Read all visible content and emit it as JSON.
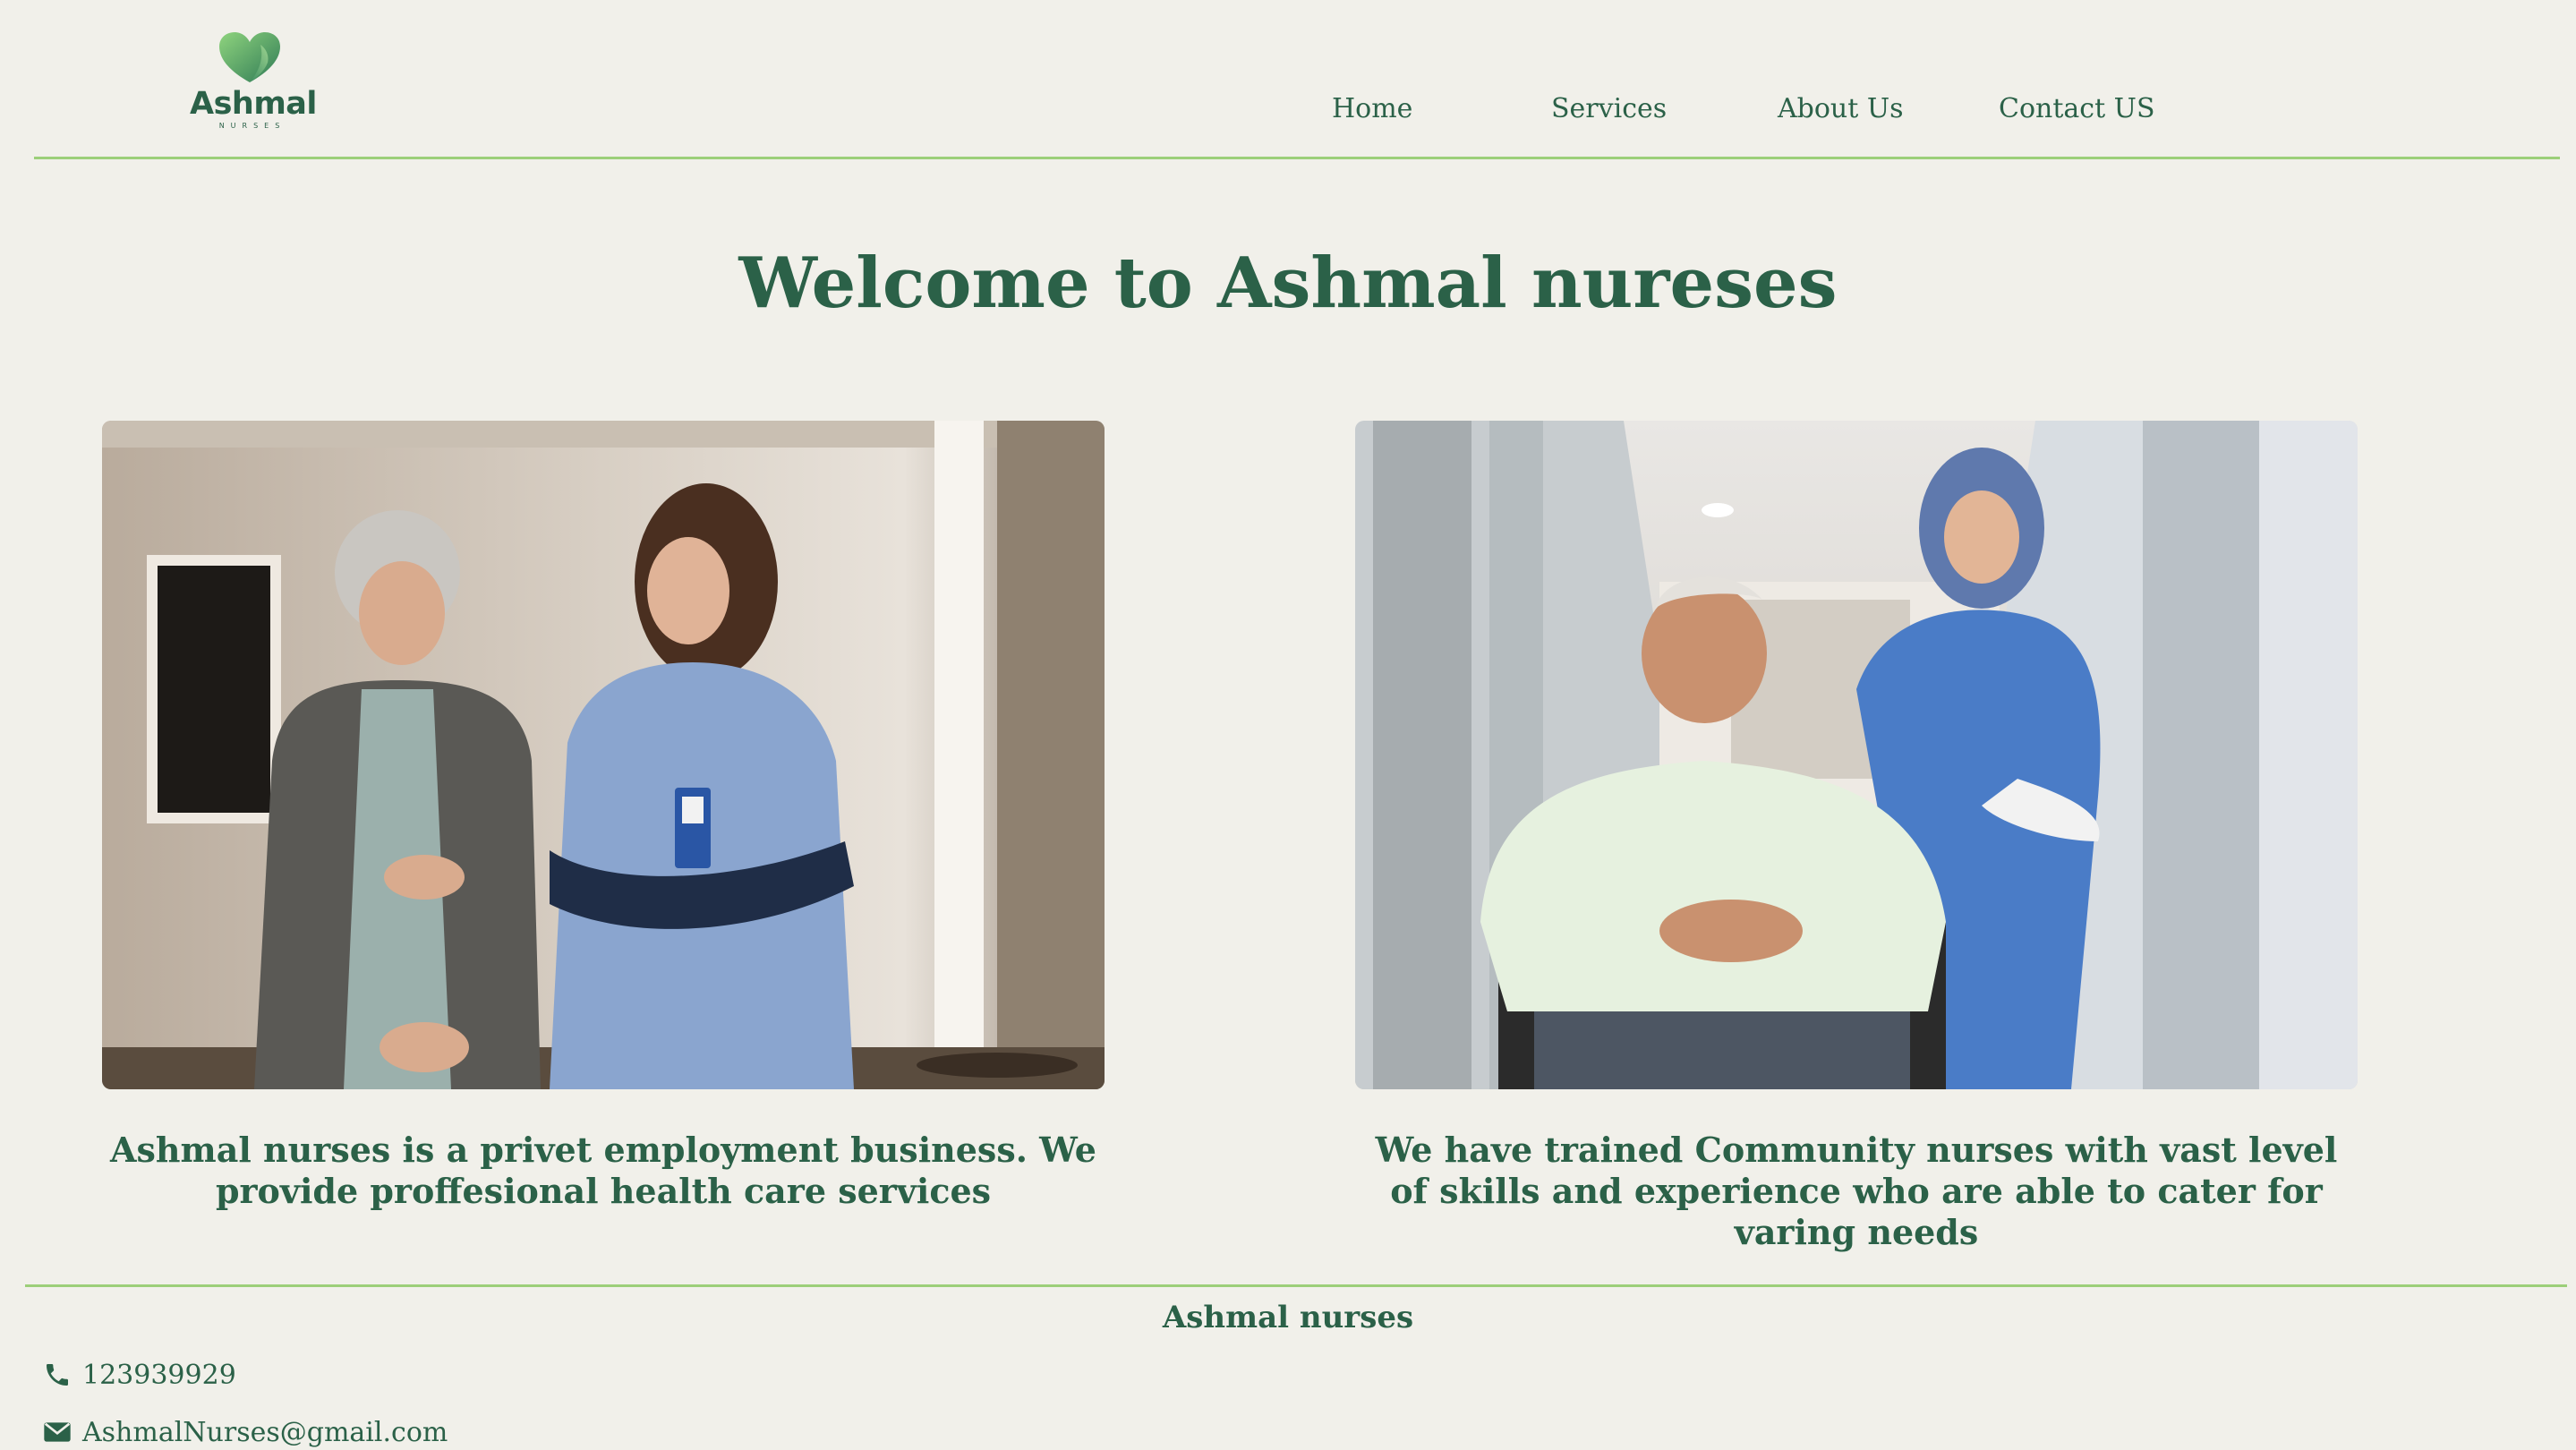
{
  "header": {
    "logo": {
      "name": "Ashmal",
      "tagline": "NURSES",
      "icon": "heart-logo-icon"
    },
    "nav": [
      {
        "label": "Home"
      },
      {
        "label": "Services"
      },
      {
        "label": "About Us"
      },
      {
        "label": "Contact US"
      }
    ]
  },
  "main": {
    "title": "Welcome to Ashmal nureses",
    "cards": [
      {
        "image": "nurse-with-elderly-woman-photo",
        "text": "Ashmal nurses is a privet employment business. We provide proffesional health care services"
      },
      {
        "image": "nurse-with-man-in-wheelchair-photo",
        "text": "We have trained Community nurses with vast level of skills and experience who are able to cater for varing needs"
      }
    ]
  },
  "footer": {
    "title": "Ashmal nurses",
    "phone": {
      "icon": "phone-icon",
      "value": "123939929"
    },
    "email": {
      "icon": "envelope-icon",
      "value": "AshmalNurses@gmail.com"
    }
  },
  "colors": {
    "background": "#f1f0ea",
    "text": "#2b6148",
    "rule": "#9ccf79",
    "logo_gradient_start": "#2f7a55",
    "logo_gradient_end": "#8fd47e"
  }
}
